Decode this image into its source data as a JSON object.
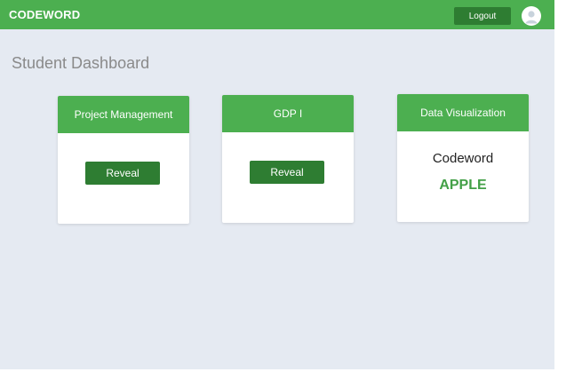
{
  "header": {
    "brand": "CODEWORD",
    "logout_label": "Logout",
    "avatar_icon": "user-avatar-icon"
  },
  "page": {
    "title": "Student Dashboard"
  },
  "cards": [
    {
      "title": "Project Management",
      "button_label": "Reveal"
    },
    {
      "title": "GDP I",
      "button_label": "Reveal"
    },
    {
      "title": "Data Visualization",
      "codeword_label": "Codeword",
      "codeword_value": "APPLE"
    }
  ],
  "colors": {
    "primary": "#4caf50",
    "button_dark": "#2e7d32",
    "codeword_green": "#43a047",
    "background": "#e5eaf2"
  }
}
